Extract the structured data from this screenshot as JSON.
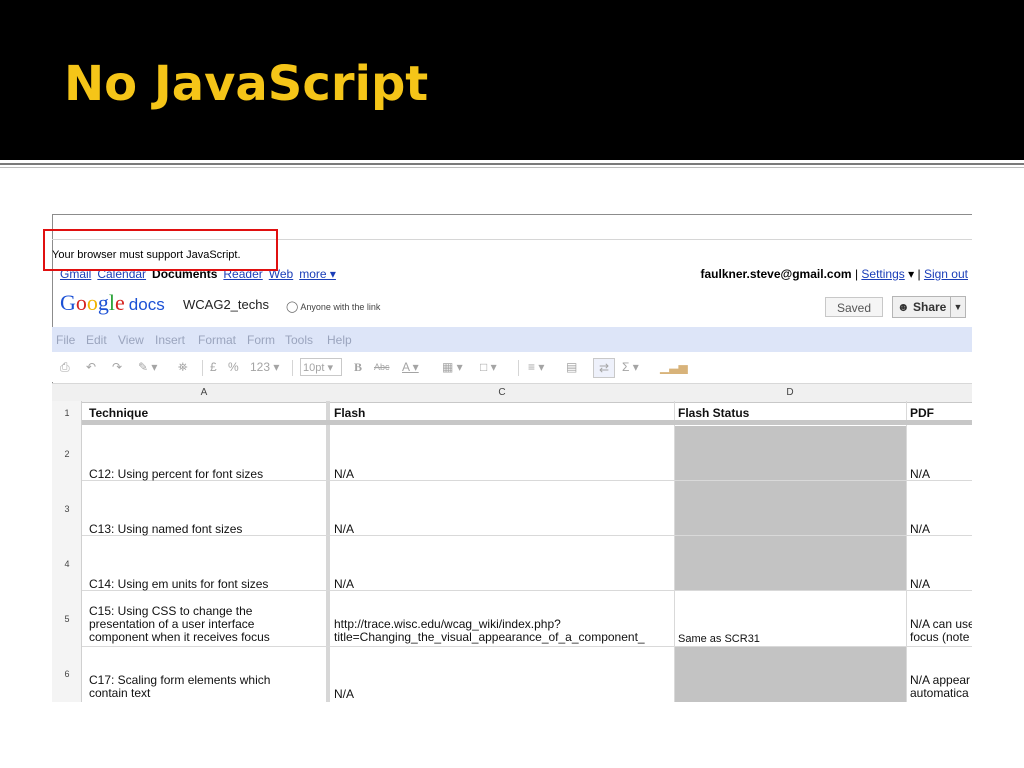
{
  "slide": {
    "title": "No JavaScript"
  },
  "screenshot": {
    "js_warning": "Your browser must support JavaScript.",
    "gbar": {
      "links": [
        "Gmail",
        "Calendar",
        "Documents",
        "Reader",
        "Web",
        "more ▾"
      ],
      "current": "Documents",
      "account_email": "faulkner.steve@gmail.com",
      "settings": "Settings",
      "settings_arrow": "▾",
      "signout": "Sign out",
      "sep": "|"
    },
    "logo": {
      "google": [
        "G",
        "o",
        "o",
        "g",
        "l",
        "e"
      ],
      "docs": "docs"
    },
    "doc_title": "WCAG2_techs",
    "sharing": "Anyone with the link",
    "saved_label": "Saved",
    "share_label": "Share",
    "menu": [
      "File",
      "Edit",
      "View",
      "Insert",
      "Format",
      "Form",
      "Tools",
      "Help"
    ],
    "toolbar": {
      "currency": "£",
      "percent": "%",
      "number": "123 ▾",
      "fontsize": "10pt ▾",
      "bold": "B",
      "strike": "Abc",
      "textcolor": "A ▾",
      "sigma": "Σ ▾"
    },
    "columns": [
      "A",
      "C",
      "D"
    ],
    "colors": {
      "accent_title": "#f5c518",
      "highlight_box": "#e01010",
      "menubar": "#dde5f8",
      "empty_cell": "#c3c3c3"
    },
    "rows": [
      {
        "num": "1",
        "technique": "Technique",
        "flash": "Flash",
        "flash_status": "Flash Status",
        "pdf": "PDF"
      },
      {
        "num": "2",
        "technique": "C12: Using percent for font sizes",
        "flash": "N/A",
        "flash_status": "",
        "pdf": "N/A"
      },
      {
        "num": "3",
        "technique": "C13: Using named font sizes",
        "flash": "N/A",
        "flash_status": "",
        "pdf": "N/A"
      },
      {
        "num": "4",
        "technique": "C14: Using em units for font sizes",
        "flash": "N/A",
        "flash_status": "",
        "pdf": "N/A"
      },
      {
        "num": "5",
        "technique": [
          "C15: Using CSS to change the",
          "presentation of a user interface",
          "component when it receives focus"
        ],
        "flash": [
          "http://trace.wisc.edu/wcag_wiki/index.php?",
          "title=Changing_the_visual_appearance_of_a_component_"
        ],
        "flash_status": "Same as SCR31",
        "pdf": [
          "N/A can use",
          "focus (note"
        ]
      },
      {
        "num": "6",
        "technique": [
          "C17: Scaling form elements which",
          "contain text"
        ],
        "flash": "N/A",
        "flash_status": "",
        "pdf": [
          "N/A appear",
          "automatica"
        ]
      }
    ]
  }
}
